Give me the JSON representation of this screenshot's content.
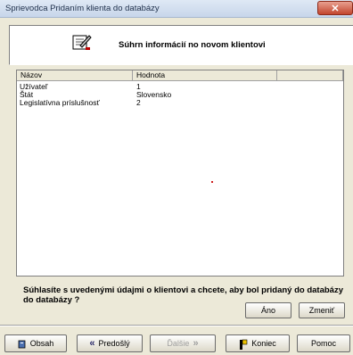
{
  "window": {
    "title": "Sprievodca Pridaním klienta do databázy"
  },
  "header": {
    "title": "Súhrn informácií no novom klientovi",
    "icon": "edit-document-icon"
  },
  "list": {
    "columns": [
      "Názov",
      "Hodnota",
      ""
    ],
    "rows": [
      {
        "name": "Užívateľ",
        "value": "1"
      },
      {
        "name": "Štát",
        "value": "Slovensko"
      },
      {
        "name": "Legislatívna príslušnosť",
        "value": "2"
      }
    ]
  },
  "question": {
    "line1": "Súhlasíte s uvedenými údajmi o klientovi a chcete, aby bol pridaný do databázy",
    "line2": "do databázy ?"
  },
  "buttons": {
    "yes": "Áno",
    "change": "Zmeniť",
    "contents": "Obsah",
    "previous": "Predošlý",
    "next": "Ďalšie",
    "finish": "Koniec",
    "help": "Pomoc"
  },
  "icons": {
    "prev": "«",
    "next": "»"
  }
}
